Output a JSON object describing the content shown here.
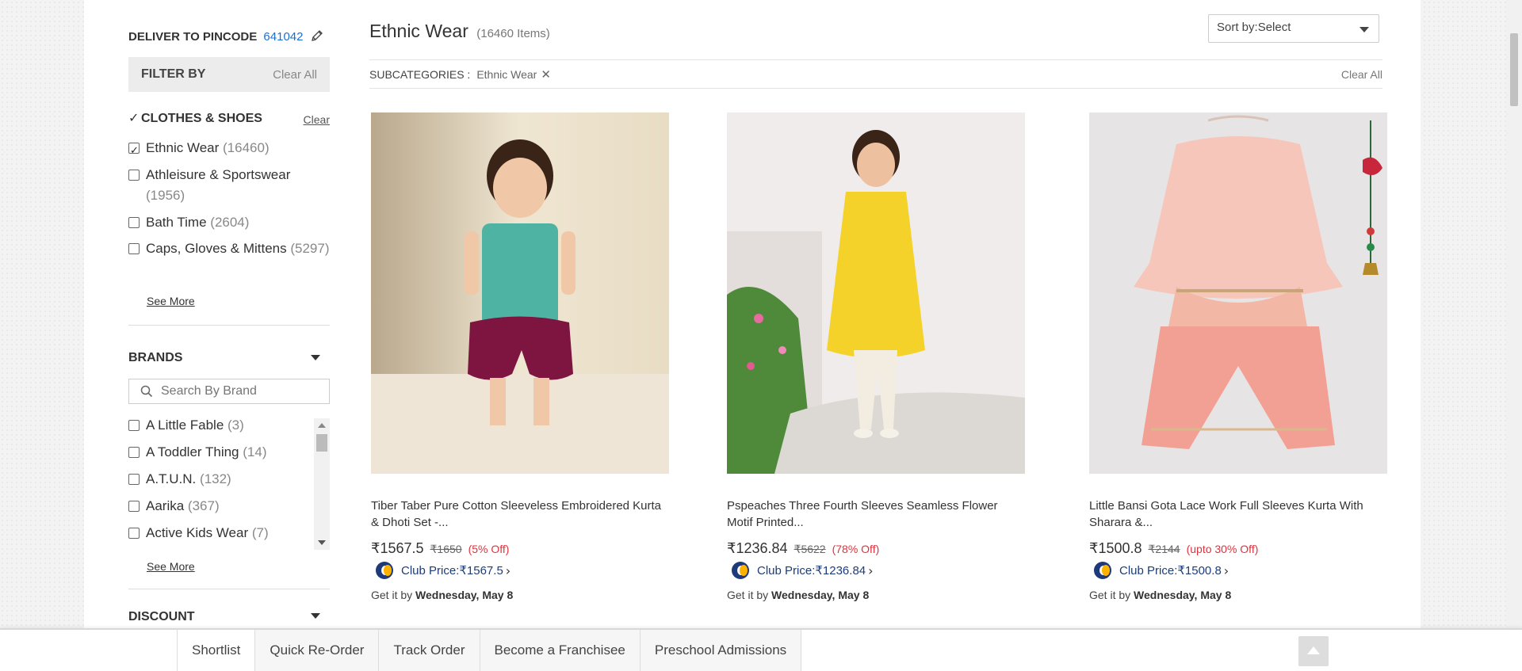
{
  "sidebar": {
    "pincode_label": "DELIVER TO PINCODE",
    "pincode_value": "641042",
    "filter_by": "FILTER BY",
    "clear_all": "Clear All",
    "clothes_section": {
      "title": "CLOTHES & SHOES",
      "clear": "Clear",
      "options": [
        {
          "label": "Ethnic Wear",
          "count": "(16460)",
          "checked": true
        },
        {
          "label": "Athleisure & Sportswear",
          "count": "(1956)",
          "checked": false
        },
        {
          "label": "Bath Time",
          "count": "(2604)",
          "checked": false
        },
        {
          "label": "Caps, Gloves & Mittens",
          "count": "(5297)",
          "checked": false
        }
      ],
      "see_more": "See More"
    },
    "brands_section": {
      "title": "BRANDS",
      "search_placeholder": "Search By Brand",
      "options": [
        {
          "label": "A Little Fable",
          "count": "(3)"
        },
        {
          "label": "A Toddler Thing",
          "count": "(14)"
        },
        {
          "label": "A.T.U.N.",
          "count": "(132)"
        },
        {
          "label": "Aarika",
          "count": "(367)"
        },
        {
          "label": "Active Kids Wear",
          "count": "(7)"
        }
      ],
      "see_more": "See More"
    },
    "discount_section": {
      "title": "DISCOUNT"
    }
  },
  "main": {
    "title": "Ethnic Wear",
    "item_count": "(16460 Items)",
    "sort_label": "Sort by:",
    "sort_value": "Select",
    "subcategories_label": "SUBCATEGORIES :",
    "subcategory_tag": "Ethnic Wear",
    "subcategory_remove": "✕",
    "clear_all": "Clear All"
  },
  "products": [
    {
      "title": "Tiber Taber Pure Cotton Sleeveless Embroidered Kurta & Dhoti Set -...",
      "price": "₹1567.5",
      "mrp": "₹1650",
      "discount": "(5% Off)",
      "club_label": "Club Price:",
      "club_price": "₹1567.5",
      "deliver_prefix": "Get it by",
      "deliver_date": "Wednesday, May 8"
    },
    {
      "title": "Pspeaches Three Fourth Sleeves Seamless Flower Motif Printed...",
      "price": "₹1236.84",
      "mrp": "₹5622",
      "discount": "(78% Off)",
      "club_label": "Club Price:",
      "club_price": "₹1236.84",
      "deliver_prefix": "Get it by",
      "deliver_date": "Wednesday, May 8"
    },
    {
      "title": "Little Bansi Gota Lace Work Full Sleeves Kurta With Sharara &...",
      "price": "₹1500.8",
      "mrp": "₹2144",
      "discount": "(upto 30% Off)",
      "club_label": "Club Price:",
      "club_price": "₹1500.8",
      "deliver_prefix": "Get it by",
      "deliver_date": "Wednesday, May 8"
    }
  ],
  "bottom_bar": {
    "tabs": [
      "Shortlist",
      "Quick Re-Order",
      "Track Order",
      "Become a Franchisee",
      "Preschool Admissions"
    ]
  },
  "colors": {
    "accent_blue": "#1a6fd3",
    "discount_red": "#e0323c",
    "club_navy": "#1e3a7a"
  }
}
